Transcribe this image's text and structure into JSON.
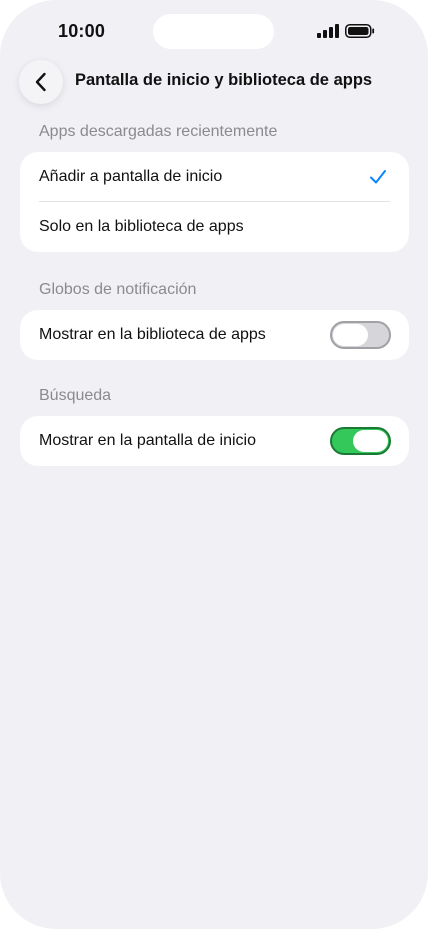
{
  "status_bar": {
    "time": "10:00",
    "signal_icon": "cellular-signal-icon",
    "battery_icon": "battery-icon"
  },
  "nav": {
    "back_icon": "chevron-left-icon",
    "title": "Pantalla de inicio y biblioteca de apps"
  },
  "sections": {
    "recent_downloads": {
      "header": "Apps descargadas recientemente",
      "options": [
        {
          "label": "Añadir a pantalla de inicio",
          "selected": true
        },
        {
          "label": "Solo en la biblioteca de apps",
          "selected": false
        }
      ]
    },
    "notification_badges": {
      "header": "Globos de notificación",
      "row_label": "Mostrar en la biblioteca de apps",
      "toggle_on": false
    },
    "search": {
      "header": "Búsqueda",
      "row_label": "Mostrar en la pantalla de inicio",
      "toggle_on": true
    }
  },
  "colors": {
    "accent_blue": "#0a84ff",
    "toggle_on_green": "#34c759",
    "background": "#f0f0f5"
  }
}
